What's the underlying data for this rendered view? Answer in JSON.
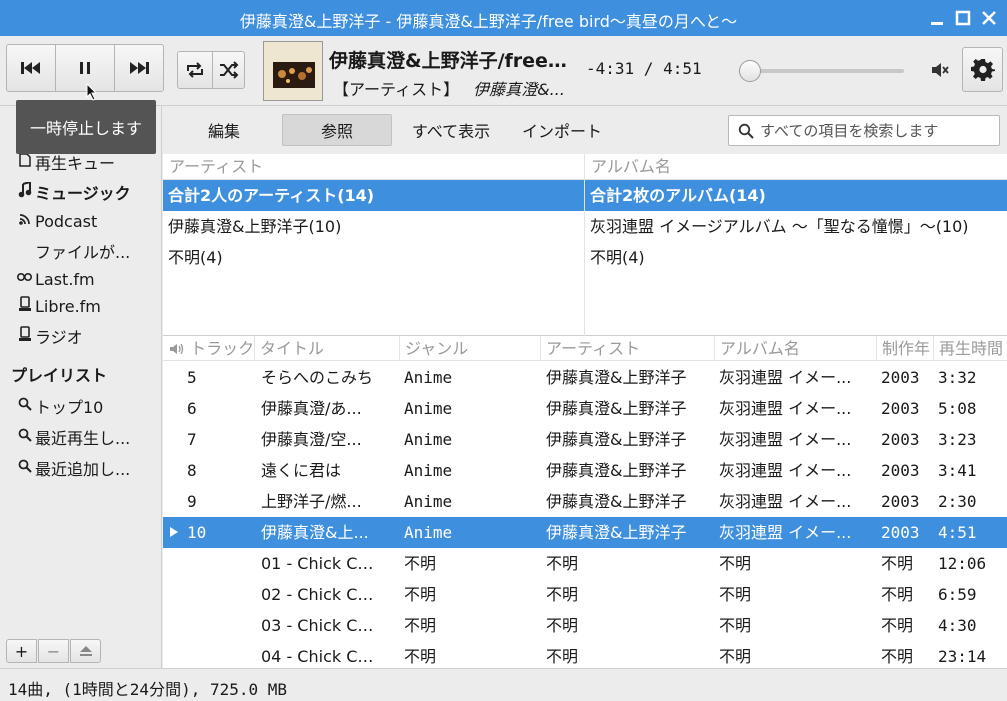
{
  "window": {
    "title": "伊藤真澄&上野洋子 - 伊藤真澄&上野洋子/free bird〜真昼の月へと〜"
  },
  "toolbar": {
    "prev_icon": "skip-previous-icon",
    "pause_icon": "pause-icon",
    "next_icon": "skip-next-icon",
    "repeat_icon": "repeat-icon",
    "shuffle_icon": "shuffle-icon",
    "now_playing_title": "伊藤真澄&上野洋子/free…",
    "now_playing_label": "【アーティスト】",
    "now_playing_artist": "伊藤真澄&...",
    "time": "-4:31 / 4:51",
    "progress": 0.06,
    "volume_icon": "volume-muted-icon",
    "settings_icon": "gear-icon",
    "tooltip": "一時停止します"
  },
  "sidebar": {
    "items": [
      {
        "label": "再生キュー",
        "icon": "document-icon"
      },
      {
        "label": "ミュージック",
        "icon": "music-note-icon"
      },
      {
        "label": "Podcast",
        "icon": "rss-icon"
      },
      {
        "label": "ファイルが...",
        "icon": ""
      },
      {
        "label": "Last.fm",
        "icon": "lastfm-icon"
      },
      {
        "label": "Libre.fm",
        "icon": "radio-icon"
      },
      {
        "label": "ラジオ",
        "icon": "radio-icon"
      }
    ],
    "playlists_header": "プレイリスト",
    "playlists": [
      {
        "label": "トップ10",
        "icon": "search-icon"
      },
      {
        "label": "最近再生し...",
        "icon": "search-icon"
      },
      {
        "label": "最近追加し...",
        "icon": "search-icon"
      }
    ],
    "add_label": "+",
    "remove_label": "−"
  },
  "subbar": {
    "tabs": [
      "編集",
      "参照",
      "すべて表示",
      "インポート"
    ],
    "active_tab": "参照",
    "search_placeholder": "すべての項目を検索します"
  },
  "browser": {
    "artist_header": "アーティスト",
    "album_header": "アルバム名",
    "artists": [
      "合計2人のアーティスト(14)",
      "伊藤真澄&上野洋子(10)",
      "不明(4)"
    ],
    "albums": [
      "合計2枚のアルバム(14)",
      "灰羽連盟 イメージアルバム 〜「聖なる憧憬」〜(10)",
      "不明(4)"
    ]
  },
  "tracklist": {
    "headers": [
      "トラック",
      "タイトル",
      "ジャンル",
      "アーティスト",
      "アルバム名",
      "制作年",
      "再生時間"
    ],
    "rows": [
      {
        "track": "5",
        "title": "そらへのこみち",
        "genre": "Anime",
        "artist": "伊藤真澄&上野洋子",
        "album": "灰羽連盟 イメー...",
        "year": "2003",
        "length": "3:32",
        "playing": false
      },
      {
        "track": "6",
        "title": "伊藤真澄/あ...",
        "genre": "Anime",
        "artist": "伊藤真澄&上野洋子",
        "album": "灰羽連盟 イメー...",
        "year": "2003",
        "length": "5:08",
        "playing": false
      },
      {
        "track": "7",
        "title": "伊藤真澄/空...",
        "genre": "Anime",
        "artist": "伊藤真澄&上野洋子",
        "album": "灰羽連盟 イメー...",
        "year": "2003",
        "length": "3:23",
        "playing": false
      },
      {
        "track": "8",
        "title": "遠くに君は",
        "genre": "Anime",
        "artist": "伊藤真澄&上野洋子",
        "album": "灰羽連盟 イメー...",
        "year": "2003",
        "length": "3:41",
        "playing": false
      },
      {
        "track": "9",
        "title": "上野洋子/燃...",
        "genre": "Anime",
        "artist": "伊藤真澄&上野洋子",
        "album": "灰羽連盟 イメー...",
        "year": "2003",
        "length": "2:30",
        "playing": false
      },
      {
        "track": "10",
        "title": "伊藤真澄&上...",
        "genre": "Anime",
        "artist": "伊藤真澄&上野洋子",
        "album": "灰羽連盟 イメー...",
        "year": "2003",
        "length": "4:51",
        "playing": true
      },
      {
        "track": "",
        "title": "01 - Chick C…",
        "genre": "不明",
        "artist": "不明",
        "album": "不明",
        "year": "不明",
        "length": "12:06",
        "playing": false
      },
      {
        "track": "",
        "title": "02 - Chick C…",
        "genre": "不明",
        "artist": "不明",
        "album": "不明",
        "year": "不明",
        "length": "6:59",
        "playing": false
      },
      {
        "track": "",
        "title": "03 - Chick C…",
        "genre": "不明",
        "artist": "不明",
        "album": "不明",
        "year": "不明",
        "length": "4:30",
        "playing": false
      },
      {
        "track": "",
        "title": "04 - Chick C…",
        "genre": "不明",
        "artist": "不明",
        "album": "不明",
        "year": "不明",
        "length": "23:14",
        "playing": false
      }
    ]
  },
  "status": {
    "text": "14曲, (1時間と24分間), 725.0 MB"
  },
  "colors": {
    "accent": "#3f8fdf"
  }
}
